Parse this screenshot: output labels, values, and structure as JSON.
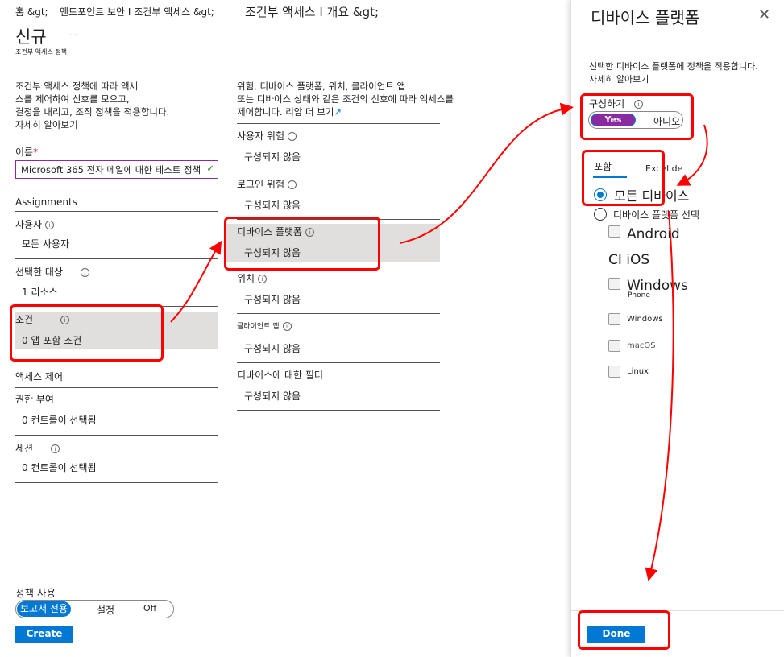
{
  "breadcrumb": [
    "홈 &gt;",
    "엔드포인트 보안 I 조건부 액세스 &gt;",
    "조건부 액세스 I 개요 &gt;"
  ],
  "page": {
    "title": "신규",
    "more": "...",
    "subtitle": "조건부 액세스 정책"
  },
  "left": {
    "description": [
      "조건부 액세스 정책에 따라 액세",
      "스를 제어하여 신호를 모으고,",
      "결정을 내리고, 조직 정책을 적용합니다.",
      "자세히 알아보기"
    ],
    "name_label": "이름",
    "name_value": "Microsoft 365 전자 메일에 대한 테스트 정책",
    "assignments": "Assignments",
    "users_label": "사용자",
    "users_value": "모든 사용자",
    "target_label": "선택한 대상",
    "target_value": "1 리소스",
    "conditions_label": "조건",
    "conditions_value": "0 앱 포함 조건",
    "access_controls": "액세스 제어",
    "grant_label": "권한 부여",
    "grant_value": "0 컨트롤이 선택됨",
    "session_label": "세션",
    "session_value": "0 컨트롤이 선택됨"
  },
  "middle": {
    "description": [
      "위험, 디바이스 플랫폼, 위치, 클라이언트 앱",
      "또는 디바이스 상태와 같은 조건의 신호에 따라 액세스를",
      "제어합니다. 리암 더 보기"
    ],
    "items": [
      {
        "label": "사용자 위험",
        "value": "구성되지 않음"
      },
      {
        "label": "로그인 위험",
        "value": "구성되지 않음"
      },
      {
        "label": "디바이스 플랫폼",
        "value": "구성되지 않음"
      },
      {
        "label": "위치",
        "value": "구성되지 않음"
      },
      {
        "label": "클라이언트 앱",
        "value": "구성되지 않음"
      },
      {
        "label": "디바이스에 대한 필터",
        "value": "구성되지 않음"
      }
    ]
  },
  "footer": {
    "enable_label": "정책 사용",
    "options": [
      "보고서 전용",
      "설정",
      "Off"
    ],
    "selected": "보고서 전용",
    "create": "Create"
  },
  "panel": {
    "title": "디바이스 플랫폼",
    "description": "선택한 디바이스 플랫폼에 정책을 적용합니다.",
    "learn_more": "자세히 알아보기",
    "configure_label": "구성하기",
    "configure_options": [
      "Yes",
      "아니오"
    ],
    "configure_selected": "Yes",
    "tabs": [
      "포함",
      "Excel de"
    ],
    "active_tab": "포함",
    "radio_all": "모든 디바이스",
    "radio_select": "디바이스 플랫폼 선택",
    "radio_selected": "모든 디바이스",
    "platforms": [
      "Android",
      "CI iOS",
      "Windows",
      "Phone",
      "Windows",
      "macOS",
      "Linux"
    ],
    "done": "Done"
  },
  "colors": {
    "accent": "#0078d4",
    "toggle_yes": "#8a2aa0",
    "annotation": "#ff0000",
    "selected_bg": "#e1dfdd"
  }
}
